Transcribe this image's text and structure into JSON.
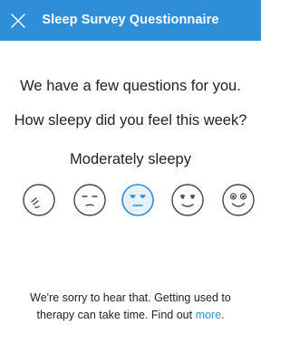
{
  "header": {
    "title": "Sleep Survey Questionnaire",
    "close_icon": "close-icon"
  },
  "survey": {
    "intro": "We have a few questions for you.",
    "question": "How sleepy did you feel this week?",
    "selected_answer": "Moderately sleepy",
    "options": [
      {
        "icon": "very-sleepy-face-icon",
        "selected": false
      },
      {
        "icon": "sleepy-face-icon",
        "selected": false
      },
      {
        "icon": "moderately-sleepy-face-icon",
        "selected": true
      },
      {
        "icon": "slightly-sleepy-face-icon",
        "selected": false
      },
      {
        "icon": "alert-face-icon",
        "selected": false
      }
    ]
  },
  "footer": {
    "message_before": "We're sorry to hear that. Getting used to therapy can take time. Find out ",
    "link_label": "more",
    "message_after": "."
  },
  "colors": {
    "accent": "#2f8ed8",
    "face_stroke": "#444444",
    "selected_fill": "#e6f1fb"
  }
}
